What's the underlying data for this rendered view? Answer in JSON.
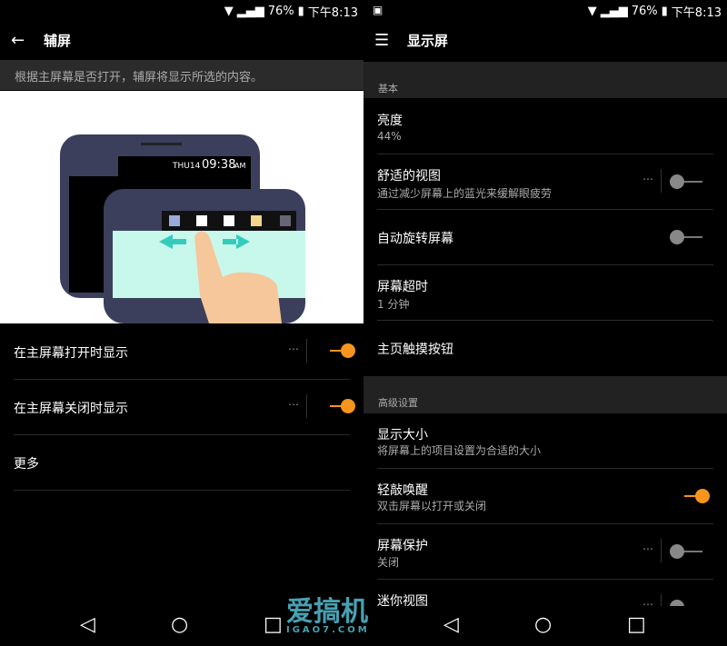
{
  "status": {
    "battery": "76%",
    "time": "下午8:13"
  },
  "left": {
    "title": "辅屏",
    "description": "根据主屏幕是否打开，辅屏将显示所选的内容。",
    "illustration": {
      "day": "THU14",
      "clock": "09:38",
      "ampm": "AM"
    },
    "items": [
      {
        "label": "在主屏幕打开时显示",
        "on": true
      },
      {
        "label": "在主屏幕关闭时显示",
        "on": true
      },
      {
        "label": "更多"
      }
    ]
  },
  "right": {
    "title": "显示屏",
    "section_basic": "基本",
    "brightness": {
      "label": "亮度",
      "value": "44%"
    },
    "comfort": {
      "label": "舒适的视图",
      "sub": "通过减少屏幕上的蓝光来缓解眼疲劳",
      "on": false
    },
    "rotate": {
      "label": "自动旋转屏幕",
      "on": false
    },
    "timeout": {
      "label": "屏幕超时",
      "value": "1 分钟"
    },
    "home_buttons": {
      "label": "主页触摸按钮"
    },
    "section_adv": "高级设置",
    "size": {
      "label": "显示大小",
      "sub": "将屏幕上的项目设置为合适的大小"
    },
    "knock": {
      "label": "轻敲唤醒",
      "sub": "双击屏幕以打开或关闭",
      "on": true
    },
    "saver": {
      "label": "屏幕保护",
      "value": "关闭",
      "on": false
    },
    "mini": {
      "label": "迷你视图",
      "on": false
    }
  },
  "more_icon": "⋯",
  "watermark": {
    "text": "爱搞机",
    "url": "IGAO7.COM"
  },
  "colors": {
    "accent": "#f7941d"
  }
}
